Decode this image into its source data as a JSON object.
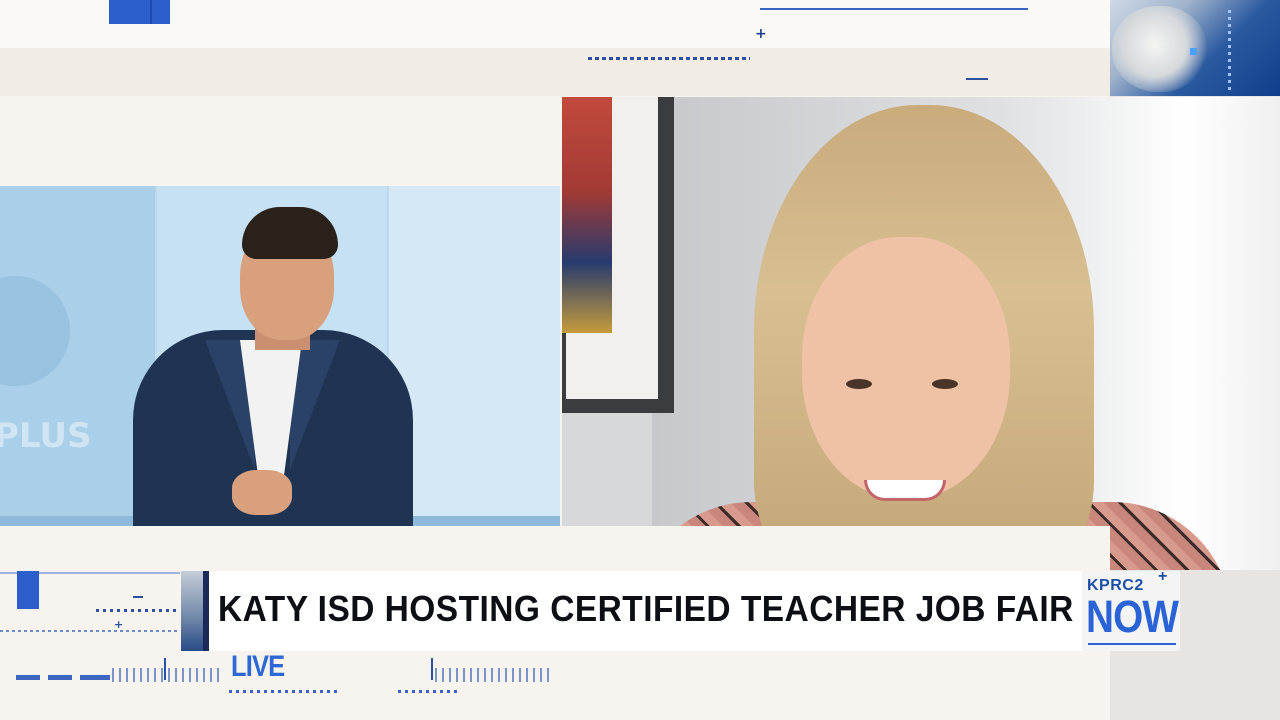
{
  "headline": "KATY ISD HOSTING CERTIFIED TEACHER JOB FAIR",
  "live_label": "LIVE",
  "logo": {
    "top": "KPRC2",
    "plus": "+",
    "main": "NOW"
  },
  "decor": {
    "top_plus": "+",
    "lower_plus": "+",
    "studio_text": "PLUS"
  },
  "colors": {
    "accent_blue": "#2d5fcc",
    "headline_text": "#0d0f14",
    "logo_blue": "#2a63d6"
  }
}
